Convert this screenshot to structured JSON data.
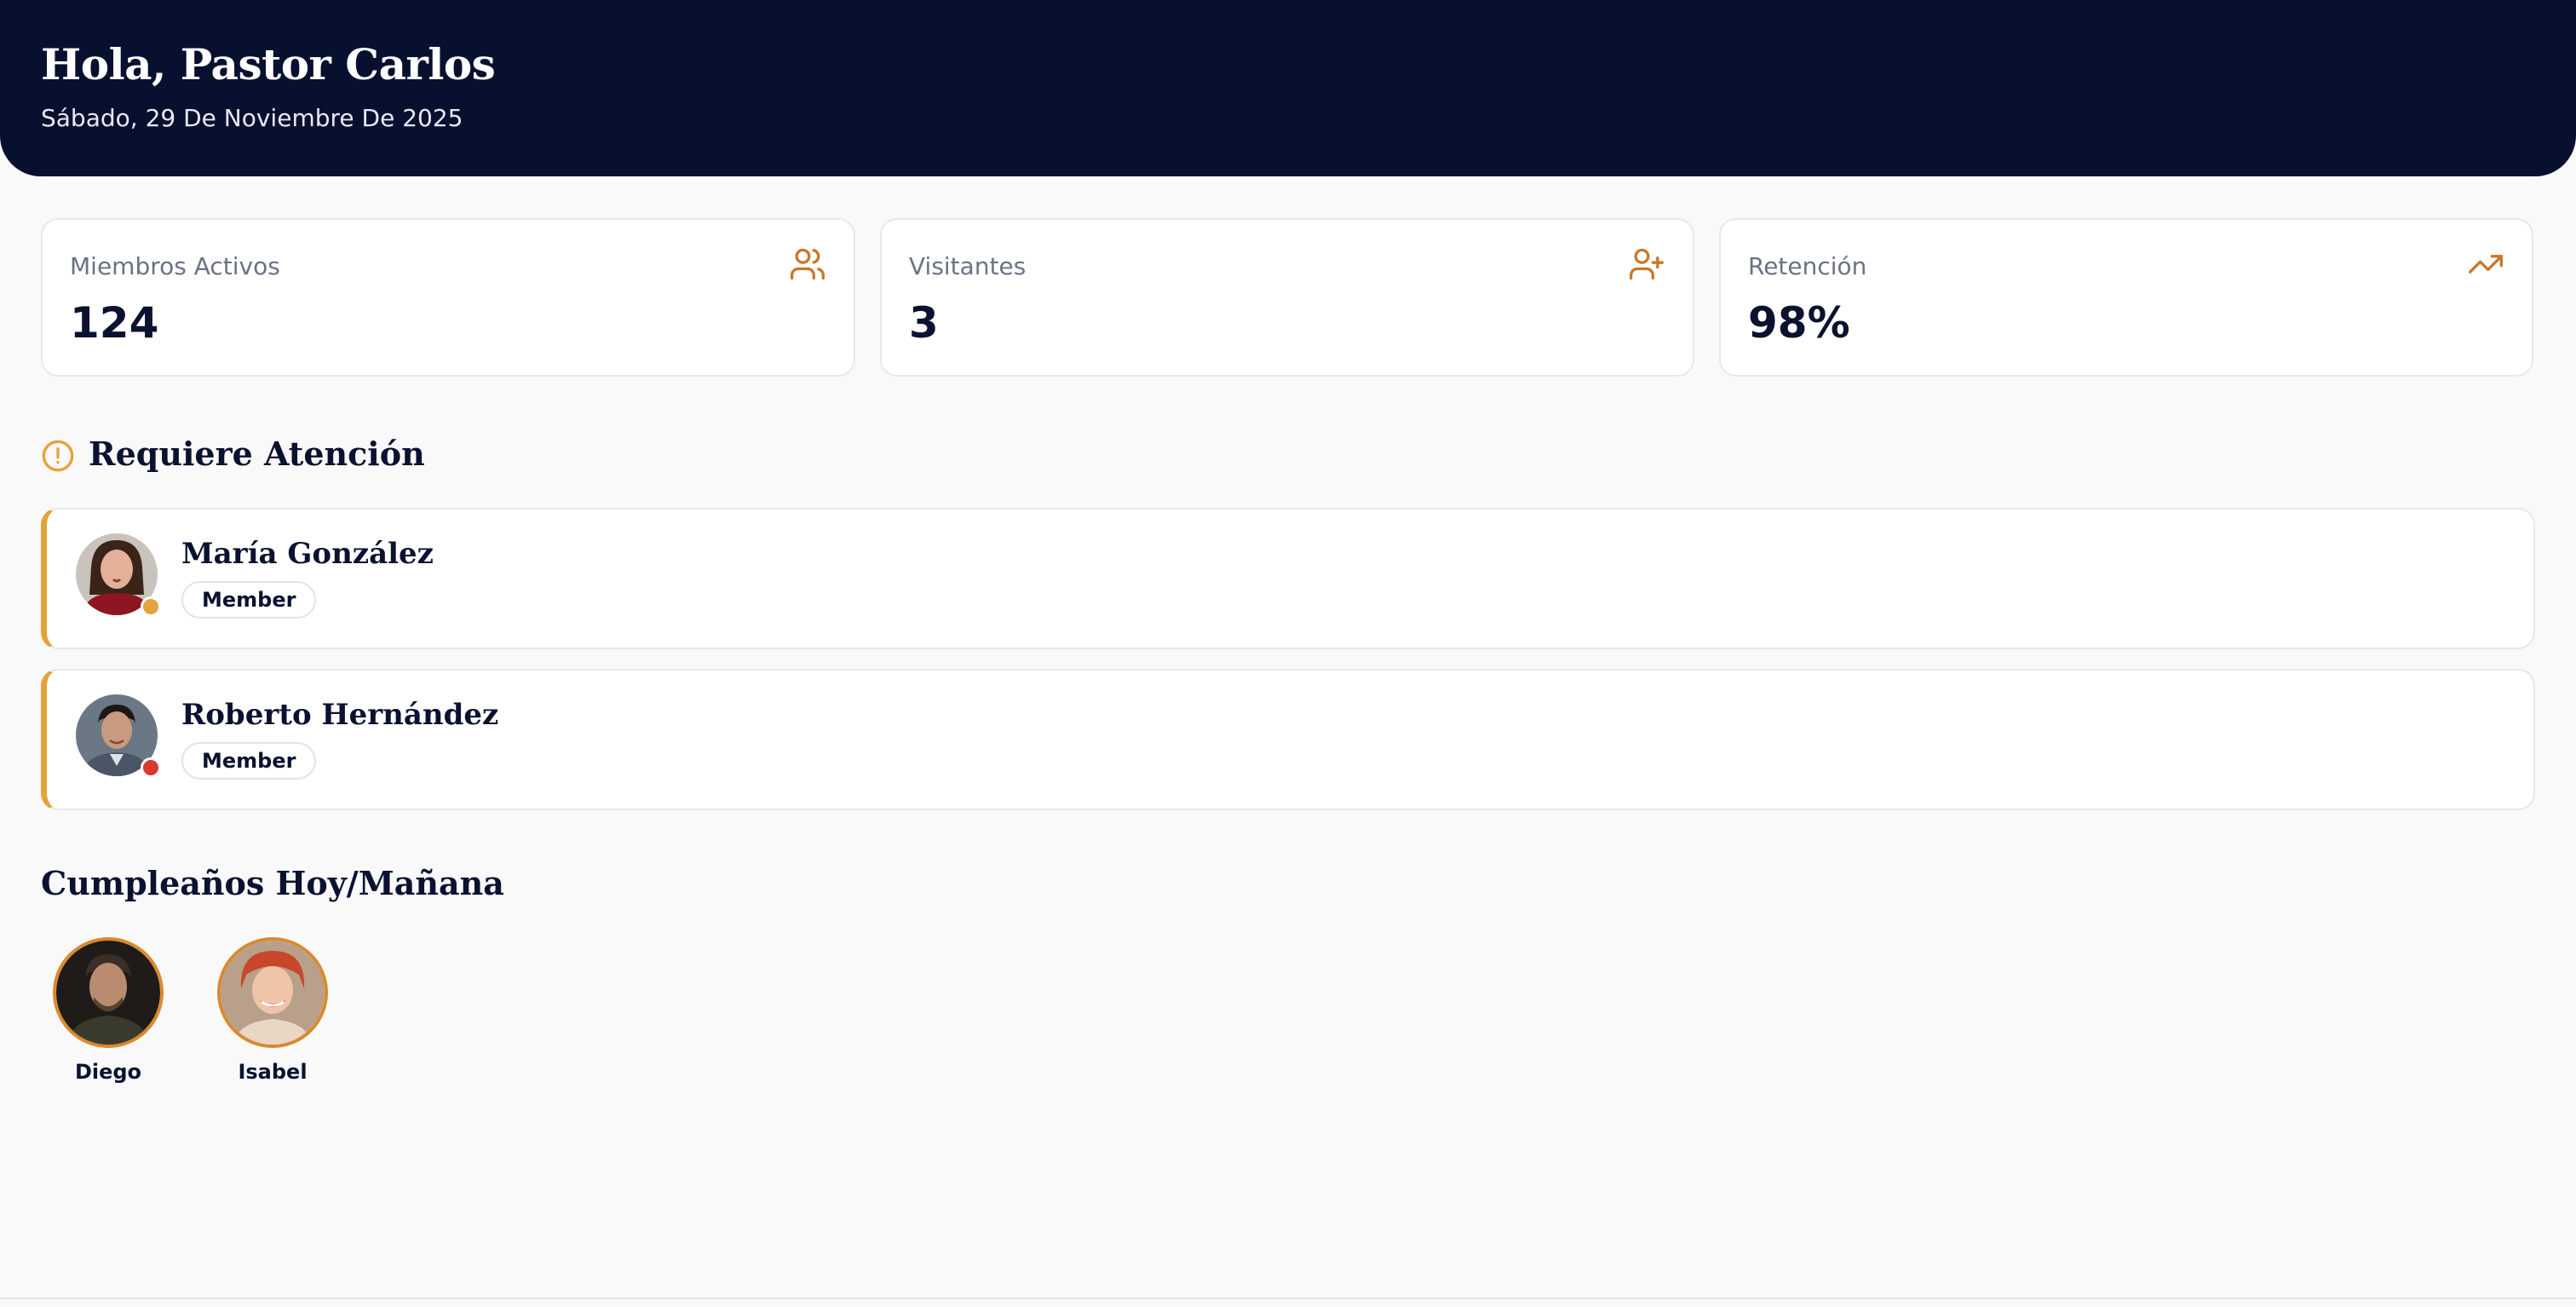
{
  "header": {
    "greeting": "Hola, Pastor Carlos",
    "date": "Sábado, 29 De Noviembre De 2025",
    "bg_color": "#081030"
  },
  "stats": [
    {
      "label": "Miembros Activos",
      "value": "124",
      "icon": "users-icon"
    },
    {
      "label": "Visitantes",
      "value": "3",
      "icon": "user-plus-icon"
    },
    {
      "label": "Retención",
      "value": "98%",
      "icon": "trending-up-icon"
    }
  ],
  "attention": {
    "title": "Requiere Atención",
    "icon": "alert-circle-icon",
    "people": [
      {
        "name": "María González",
        "role": "Member",
        "status_color": "#e3a33a"
      },
      {
        "name": "Roberto Hernández",
        "role": "Member",
        "status_color": "#d93a2f"
      }
    ]
  },
  "birthdays": {
    "title": "Cumpleaños Hoy/Mañana",
    "people": [
      {
        "name": "Diego"
      },
      {
        "name": "Isabel"
      }
    ]
  },
  "colors": {
    "accent": "#e3a33a",
    "icon_accent": "#c8782a",
    "navy": "#081030"
  }
}
